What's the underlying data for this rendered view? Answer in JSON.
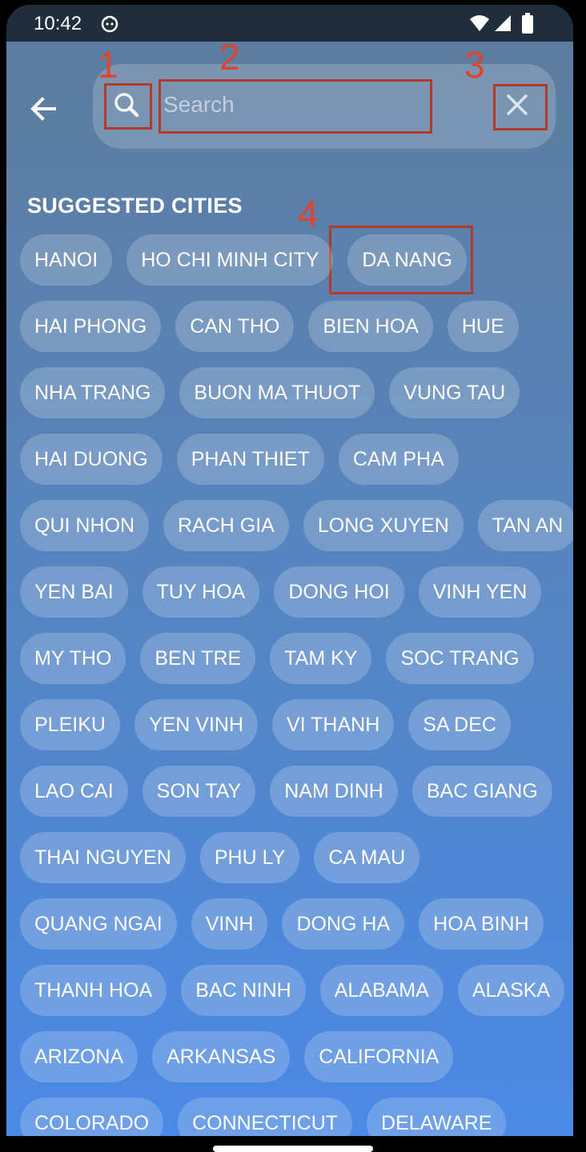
{
  "status_bar": {
    "time": "10:42"
  },
  "search": {
    "placeholder": "Search"
  },
  "annotations": [
    "1",
    "2",
    "3",
    "4"
  ],
  "section_title": "SUGGESTED CITIES",
  "chip_rows": [
    [
      "HANOI",
      "HO CHI MINH CITY",
      "DA NANG"
    ],
    [
      "HAI PHONG",
      "CAN THO",
      "BIEN HOA",
      "HUE"
    ],
    [
      "NHA TRANG",
      "BUON MA THUOT",
      "VUNG TAU"
    ],
    [
      "HAI DUONG",
      "PHAN THIET",
      "CAM PHA"
    ],
    [
      "QUI NHON",
      "RACH GIA",
      "LONG XUYEN",
      "TAN AN"
    ],
    [
      "YEN BAI",
      "TUY HOA",
      "DONG HOI",
      "VINH YEN"
    ],
    [
      "MY THO",
      "BEN TRE",
      "TAM KY",
      "SOC TRANG"
    ],
    [
      "PLEIKU",
      "YEN VINH",
      "VI THANH",
      "SA DEC"
    ],
    [
      "LAO CAI",
      "SON TAY",
      "NAM DINH",
      "BAC GIANG"
    ],
    [
      "THAI NGUYEN",
      "PHU LY",
      "CA MAU"
    ],
    [
      "QUANG NGAI",
      "VINH",
      "DONG HA",
      "HOA BINH"
    ],
    [
      "THANH HOA",
      "BAC NINH",
      "ALABAMA",
      "ALASKA"
    ],
    [
      "ARIZONA",
      "ARKANSAS",
      "CALIFORNIA"
    ],
    [
      "COLORADO",
      "CONNECTICUT",
      "DELAWARE"
    ]
  ]
}
